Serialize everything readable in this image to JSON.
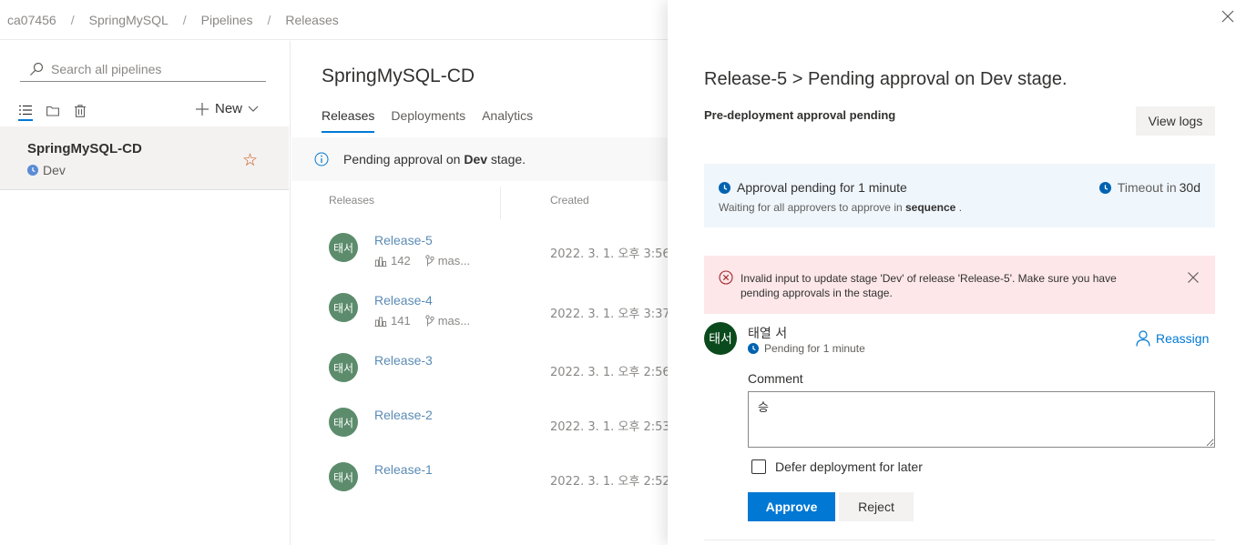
{
  "breadcrumb": [
    "ca07456",
    "SpringMySQL",
    "Pipelines",
    "Releases"
  ],
  "left": {
    "search_placeholder": "Search all pipelines",
    "new_label": "New",
    "pipeline": {
      "name": "SpringMySQL-CD",
      "stage": "Dev"
    }
  },
  "main": {
    "title": "SpringMySQL-CD",
    "tabs": [
      "Releases",
      "Deployments",
      "Analytics"
    ],
    "banner": {
      "prefix": "Pending approval on ",
      "stage": "Dev",
      "suffix": " stage."
    },
    "columns": {
      "releases": "Releases",
      "created": "Created"
    },
    "releases": [
      {
        "initials": "태서",
        "name": "Release-5",
        "build": "142",
        "branch": "mas...",
        "created": "2022. 3. 1. 오후 3:56:"
      },
      {
        "initials": "태서",
        "name": "Release-4",
        "build": "141",
        "branch": "mas...",
        "created": "2022. 3. 1. 오후 3:37:"
      },
      {
        "initials": "태서",
        "name": "Release-3",
        "created": "2022. 3. 1. 오후 2:56:"
      },
      {
        "initials": "태서",
        "name": "Release-2",
        "created": "2022. 3. 1. 오후 2:53:"
      },
      {
        "initials": "태서",
        "name": "Release-1",
        "created": "2022. 3. 1. 오후 2:52:"
      }
    ]
  },
  "panel": {
    "title": "Release-5 > Pending approval on Dev stage.",
    "subtitle": "Pre-deployment approval pending",
    "view_logs": "View logs",
    "approval": {
      "status": "Approval pending for 1 minute",
      "timeout_label": "Timeout in",
      "timeout_value": "30d",
      "waiting_prefix": "Waiting for all approvers to approve in ",
      "waiting_mode": "sequence",
      "waiting_suffix": " ."
    },
    "error": "Invalid input to update stage 'Dev' of release 'Release-5'. Make sure you have pending approvals in the stage.",
    "approver": {
      "initials": "태서",
      "name": "태열 서",
      "status": "Pending for 1 minute"
    },
    "reassign": "Reassign",
    "comment_label": "Comment",
    "comment_value": "승",
    "defer_label": "Defer deployment for later",
    "approve": "Approve",
    "reject": "Reject"
  },
  "colors": {
    "accent": "#0078d4",
    "link": "#5b8bb5",
    "avatar": "#5c8c6c",
    "error_bg": "#fde7e9",
    "info_bg": "#eff6fc"
  }
}
